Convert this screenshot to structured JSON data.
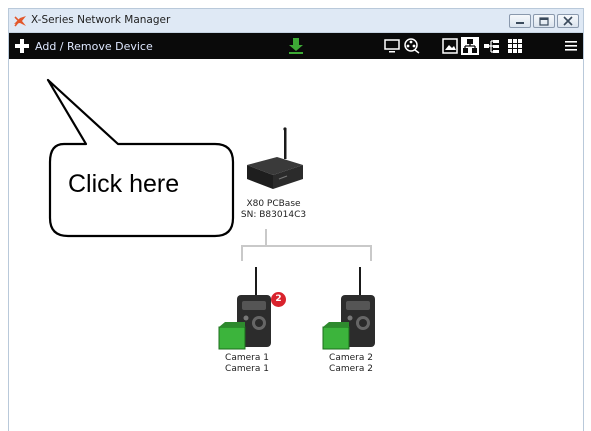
{
  "window": {
    "title": "X-Series Network Manager"
  },
  "toolbar": {
    "add_remove_label": "Add / Remove Device"
  },
  "base_station": {
    "name": "X80 PCBase",
    "serial": "SN: B83014C3"
  },
  "cameras": [
    {
      "name": "Camera 1",
      "subtitle": "Camera 1",
      "badge": "2"
    },
    {
      "name": "Camera 2",
      "subtitle": "Camera 2"
    }
  ],
  "callout": {
    "text": "Click here"
  },
  "colors": {
    "toolbar_bg": "#0a0a0a",
    "titlebar_bg": "#dfe9f5",
    "download_green": "#3da935",
    "badge_red": "#d9232d",
    "battery_green": "#3cb43c"
  },
  "icons": [
    "app-logo-icon",
    "minimize-icon",
    "maximize-icon",
    "close-icon",
    "plus-icon",
    "download-icon",
    "monitor-icon",
    "film-reel-icon",
    "image-view-icon",
    "network-tree-icon",
    "branch-view-icon",
    "grid-view-icon",
    "hamburger-menu-icon"
  ]
}
